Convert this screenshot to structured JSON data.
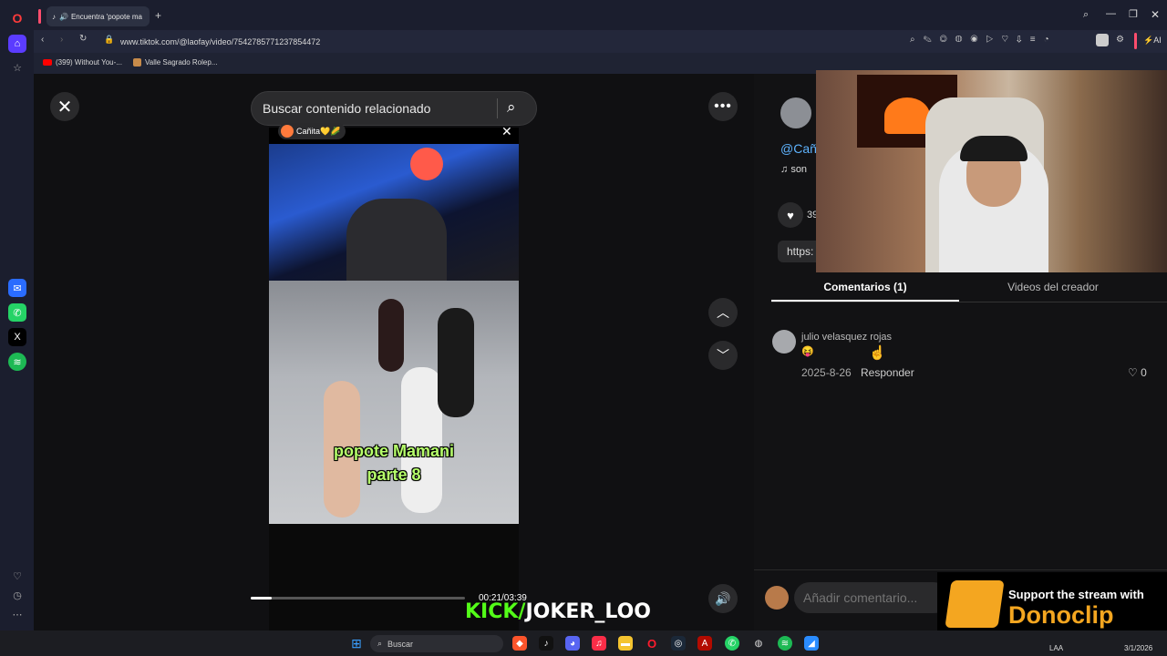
{
  "browser": {
    "tab_title": "Encuentra 'popote ma",
    "url": "www.tiktok.com/@laofay/video/7542785771237854472",
    "bookmarks": [
      {
        "label": "(399) Without You-..."
      },
      {
        "label": "Valle Sagrado Rolep..."
      }
    ],
    "ai_label": "AI"
  },
  "player": {
    "search_placeholder": "Buscar contenido relacionado",
    "creator_tag": "Cañita💛🌽",
    "video_caption_line1": "popote Mamani",
    "video_caption_line2": "parte 8",
    "time": "00:21/03:39",
    "progress": 0.096,
    "kick_prefix": "KICK/",
    "kick_channel": "JOKER_LOO"
  },
  "right_panel": {
    "creator_handle": "@Cañ",
    "music": "son",
    "like_count": "39",
    "link_text": "https:",
    "tabs": {
      "comments": "Comentarios (1)",
      "creator_videos": "Videos del creador"
    },
    "comment": {
      "author": "julio velasquez rojas",
      "emoji": "😝",
      "date": "2025-8-26",
      "reply": "Responder",
      "likes": "0"
    },
    "add_comment_placeholder": "Añadir comentario..."
  },
  "donoclip": {
    "line1": "Support the stream with",
    "line2": "Donoclip"
  },
  "taskbar": {
    "search_label": "Buscar",
    "lang": "LAA",
    "date": "3/1/2026"
  },
  "colors": {
    "kick_green": "#53fc18",
    "link_blue": "#5fb4ff",
    "donoclip_orange": "#f4a620",
    "caption_green": "#b6ff6b"
  }
}
